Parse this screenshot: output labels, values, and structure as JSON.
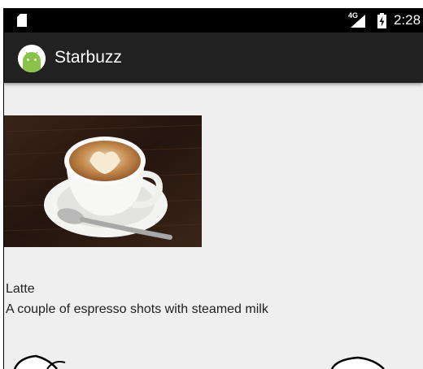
{
  "status_bar": {
    "network": "4G",
    "time": "2:28"
  },
  "app_bar": {
    "title": "Starbuzz",
    "icon": "android-icon"
  },
  "drink": {
    "image_icon": "latte-photo",
    "name": "Latte",
    "description": "A couple of espresso shots with steamed milk"
  },
  "colors": {
    "status_bar": "#000000",
    "app_bar": "#212121",
    "background": "#efefef",
    "android_green": "#8bc34a"
  }
}
